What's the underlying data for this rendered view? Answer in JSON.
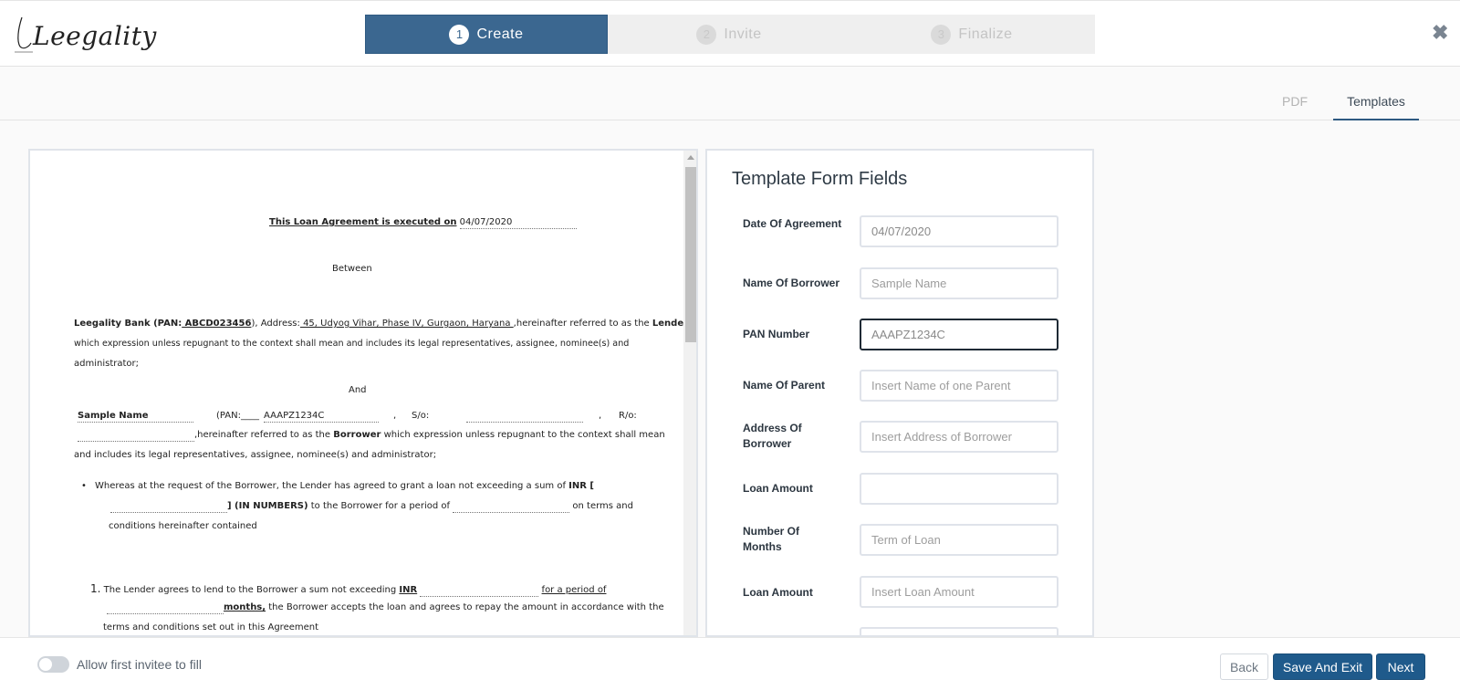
{
  "header": {
    "logo_text": "Leegality",
    "steps": [
      {
        "num": "1",
        "label": "Create"
      },
      {
        "num": "2",
        "label": "Invite"
      },
      {
        "num": "3",
        "label": "Finalize"
      }
    ],
    "close_glyph": "✖"
  },
  "tabs": {
    "pdf": "PDF",
    "templates": "Templates"
  },
  "document": {
    "title_prefix": "This Loan Agreement is executed on",
    "title_date": "04/07/2020",
    "between": "Between",
    "lender_bank": "Leegality Bank (PAN:",
    "lender_pan": " ABCD023456",
    "lender_mid": "), Address:",
    "lender_address": " 45, Udyog Vihar, Phase IV, Gurgaon, Haryana ",
    "lender_tail": ",hereinafter referred to as the",
    "lender_word": "Lender",
    "lender_line2": "which expression unless repugnant to the context shall mean and includes its legal representatives, assignee, nominee(s) and",
    "lender_line3": "administrator;",
    "and": "And",
    "borrower_name": "Sample Name",
    "pan_label": "(PAN:____",
    "borrower_pan": "AAAPZ1234C",
    "comma1": ",",
    "so_label": "S/o:",
    "comma2": ",",
    "ro_label": "R/o:",
    "borrower_line2_a": ",hereinafter referred to as the",
    "borrower_word": "Borrower",
    "borrower_line2_b": "which expression unless repugnant to the context shall mean",
    "borrower_line3": "and includes its legal representatives, assignee, nominee(s) and administrator;",
    "bullet_line1_a": "Whereas at the request of the Borrower, the Lender has agreed to grant a loan not exceeding a sum of",
    "bullet_inr": "INR [",
    "bullet_line2_a": "] (IN NUMBERS)",
    "bullet_line2_b": "to the Borrower for a period of",
    "bullet_line2_c": "on terms and",
    "bullet_line3": "conditions hereinafter contained",
    "clause1_num": "1.",
    "clause1_a": "The Lender agrees to lend to the Borrower a sum not exceeding",
    "clause1_inr": "INR",
    "clause1_period": "for a period of",
    "clause1_months": "months,",
    "clause1_b": "the Borrower accepts the loan and agrees to repay the amount in accordance with the",
    "clause1_c": "terms and conditions set out in this Agreement"
  },
  "form": {
    "title": "Template Form Fields",
    "fields": [
      {
        "label": "Date Of Agreement",
        "value": "04/07/2020",
        "placeholder": ""
      },
      {
        "label": "Name Of Borrower",
        "value": "",
        "placeholder": "Sample Name"
      },
      {
        "label": "PAN Number",
        "value": "AAAPZ1234C",
        "placeholder": ""
      },
      {
        "label": "Name Of Parent",
        "value": "",
        "placeholder": "Insert Name of one Parent"
      },
      {
        "label": "Address Of Borrower",
        "value": "",
        "placeholder": "Insert Address of Borrower"
      },
      {
        "label": "Loan Amount",
        "value": "",
        "placeholder": ""
      },
      {
        "label": "Number Of Months",
        "value": "",
        "placeholder": "Term of Loan"
      },
      {
        "label": "Loan Amount",
        "value": "",
        "placeholder": "Insert Loan Amount"
      }
    ]
  },
  "footer": {
    "toggle_label": "Allow first invitee to fill",
    "back": "Back",
    "save_exit": "Save And Exit",
    "next": "Next"
  },
  "colors": {
    "primary": "#1f5a8b",
    "step_active": "#3b6790"
  }
}
